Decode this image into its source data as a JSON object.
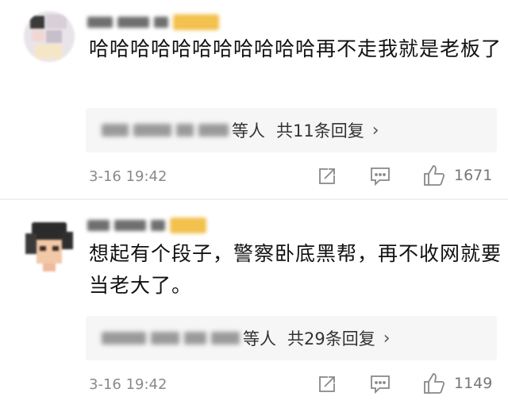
{
  "comments": [
    {
      "content": "哈哈哈哈哈哈哈哈哈哈哈再不走我就是老板了",
      "reply_suffix": "等人",
      "reply_count": "共11条回复",
      "time": "3-16 19:42",
      "likes": "1671",
      "icons": [
        "share-icon",
        "comment-icon",
        "like-icon"
      ]
    },
    {
      "content": "想起有个段子，警察卧底黑帮，再不收网就要当老大了。",
      "reply_suffix": "等人",
      "reply_count": "共29条回复",
      "time": "3-16 19:42",
      "likes": "1149",
      "icons": [
        "share-icon",
        "comment-icon",
        "like-icon"
      ]
    }
  ],
  "colors": {
    "text": "#111111",
    "meta": "#8a8a8a",
    "reply_bg": "#f6f6f6"
  }
}
